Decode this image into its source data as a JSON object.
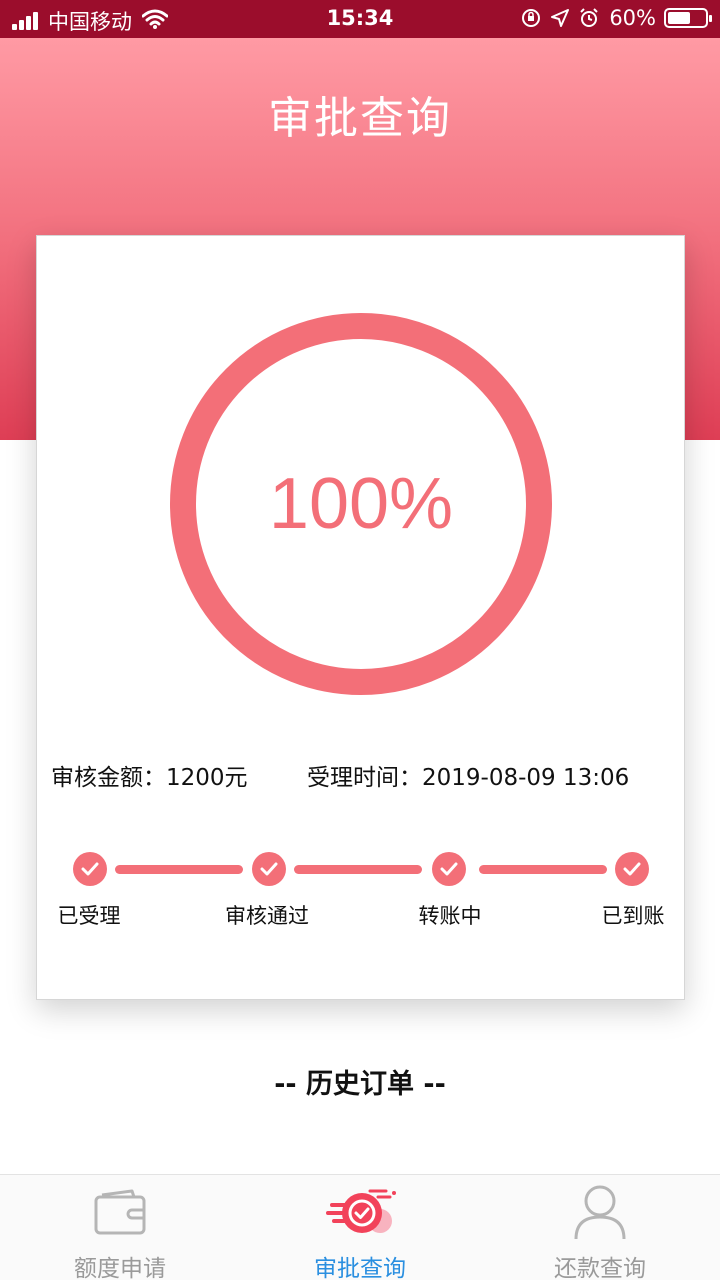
{
  "status_bar": {
    "carrier": "中国移动",
    "time": "15:34",
    "battery": "60%",
    "battery_level": 0.6
  },
  "header": {
    "title": "审批查询"
  },
  "card": {
    "progress_text": "100%",
    "progress_value": 1.0,
    "amount_label": "审核金额：",
    "amount_value": "1200元",
    "time_label": "受理时间：",
    "time_value": "2019-08-09 13:06",
    "steps": [
      {
        "label": "已受理"
      },
      {
        "label": "审核通过"
      },
      {
        "label": "转账中"
      },
      {
        "label": "已到账"
      }
    ]
  },
  "history": {
    "title": "-- 历史订单 --"
  },
  "tab_bar": {
    "tabs": [
      {
        "label": "额度申请",
        "icon": "wallet-icon"
      },
      {
        "label": "审批查询",
        "icon": "approval-check-icon"
      },
      {
        "label": "还款查询",
        "icon": "user-icon"
      }
    ],
    "active_index": 1
  },
  "colors": {
    "accent": "#f36f78",
    "status_bar": "#9b0d2c",
    "tab_active": "#2a8fe0",
    "tab_inactive": "#9a9a9a"
  }
}
